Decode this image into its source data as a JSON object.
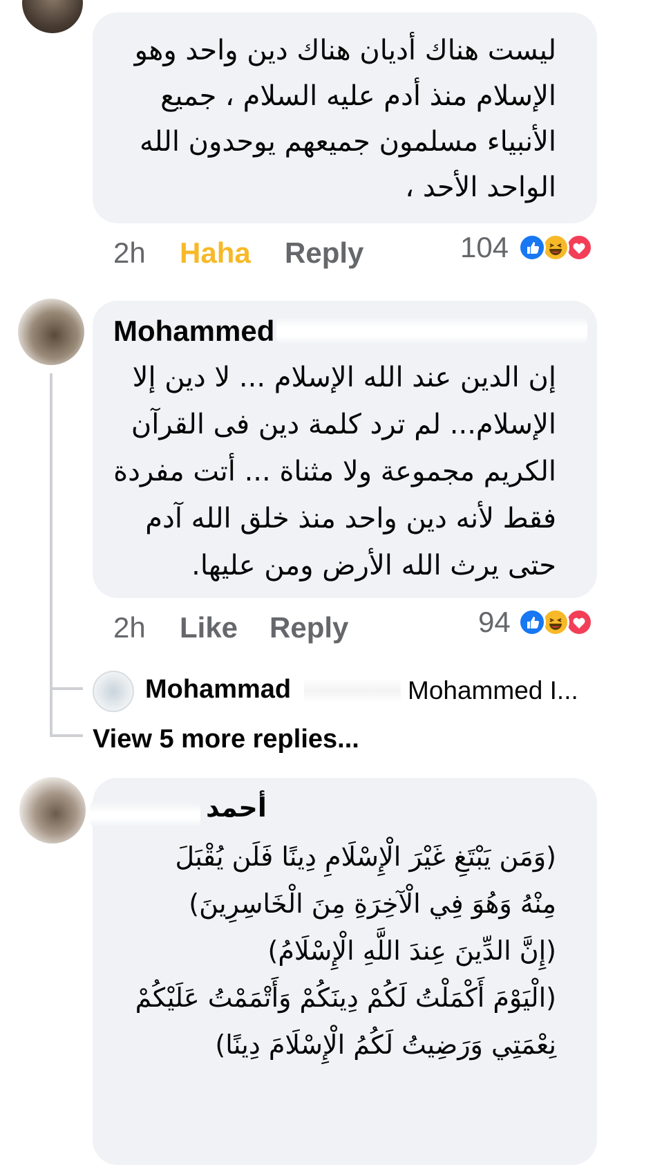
{
  "colors": {
    "haha": "#f7b928",
    "like": "#1877f2",
    "love": "#f33e58",
    "meta": "#65676b",
    "bubble": "#f0f2f5"
  },
  "comment1": {
    "lines": [
      "ليست هناك أديان هناك دين واحد وهو",
      "الإسلام منذ أدم عليه السلام ، جميع",
      "الأنبياء مسلمون جميعهم يوحدون الله",
      "الواحد الأحد ،"
    ],
    "time": "2h",
    "reaction_label": "Haha",
    "reply_label": "Reply",
    "reaction_count": "104",
    "reaction_icons": [
      "like-icon",
      "haha-icon",
      "love-icon"
    ]
  },
  "comment2": {
    "author": "Mohammed",
    "lines": [
      "إن الدين عند الله الإسلام ... لا دين إلا",
      "الإسلام... لم ترد كلمة دين فى القرآن",
      "الكريم مجموعة ولا مثناة ... أتت مفردة",
      "فقط لأنه دين واحد منذ خلق الله آدم",
      "حتى يرث الله الأرض ومن عليها."
    ],
    "time": "2h",
    "like_label": "Like",
    "reply_label": "Reply",
    "reaction_count": "94",
    "reaction_icons": [
      "like-icon",
      "haha-icon",
      "love-icon"
    ]
  },
  "reply_preview": {
    "author": "Mohammad",
    "text": "Mohammed I..."
  },
  "view_more": "View 5 more replies...",
  "comment3": {
    "author": "أحمد",
    "lines": [
      "(وَمَن يَبْتَغِ غَيْرَ الْإِسْلَامِ دِينًا فَلَن يُقْبَلَ",
      "مِنْهُ وَهُوَ فِي الْآخِرَةِ مِنَ الْخَاسِرِينَ)",
      "(إِنَّ الدِّينَ عِندَ اللَّهِ الْإِسْلَامُ)",
      "(الْيَوْمَ أَكْمَلْتُ لَكُمْ دِينَكُمْ وَأَتْمَمْتُ عَلَيْكُمْ",
      "نِعْمَتِي وَرَضِيتُ لَكُمُ الْإِسْلَامَ دِينًا)"
    ]
  }
}
